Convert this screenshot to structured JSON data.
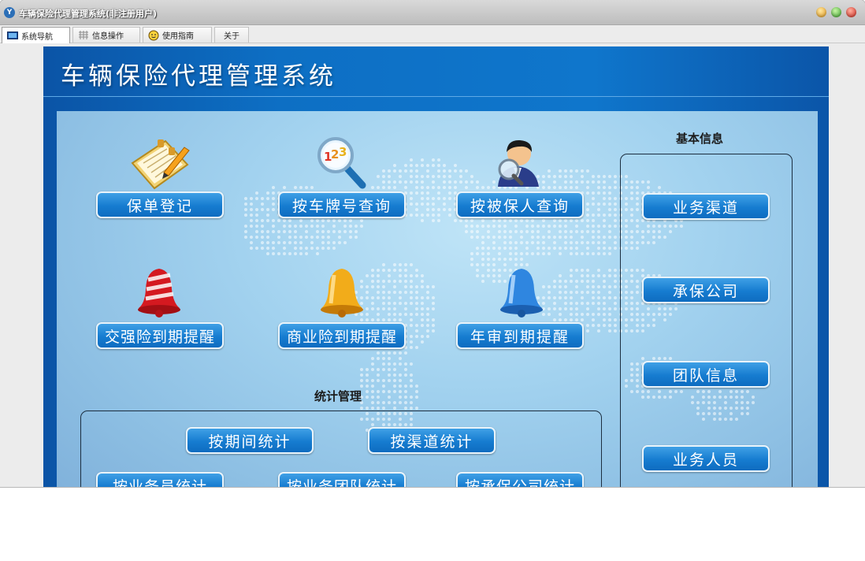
{
  "window": {
    "title": "车辆保险代理管理系统(非注册用户)",
    "logo_text": "Y"
  },
  "tabs": [
    {
      "label": "系统导航",
      "icon": "monitor-icon"
    },
    {
      "label": "信息操作",
      "icon": "grid-icon"
    },
    {
      "label": "使用指南",
      "icon": "smiley-icon"
    },
    {
      "label": "关于",
      "icon": ""
    }
  ],
  "header": {
    "title": "车辆保险代理管理系统"
  },
  "main_buttons": [
    {
      "label": "保单登记",
      "icon": "notepad-pen-icon"
    },
    {
      "label": "按车牌号查询",
      "icon": "magnifier-123-icon"
    },
    {
      "label": "按被保人查询",
      "icon": "person-search-icon"
    },
    {
      "label": "交强险到期提醒",
      "icon": "red-bell-icon"
    },
    {
      "label": "商业险到期提醒",
      "icon": "gold-bell-icon"
    },
    {
      "label": "年审到期提醒",
      "icon": "blue-bell-icon"
    }
  ],
  "basic_info": {
    "title": "基本信息",
    "buttons": [
      "业务渠道",
      "承保公司",
      "团队信息",
      "业务人员"
    ]
  },
  "statistics": {
    "title": "统计管理",
    "buttons": [
      "按期间统计",
      "按渠道统计",
      "按业务员统计",
      "按业务团队统计",
      "按承保公司统计"
    ]
  },
  "colors": {
    "header_blue": "#0d6fc4",
    "button_blue": "#167cd0",
    "panel_light": "#a2d2ef"
  }
}
